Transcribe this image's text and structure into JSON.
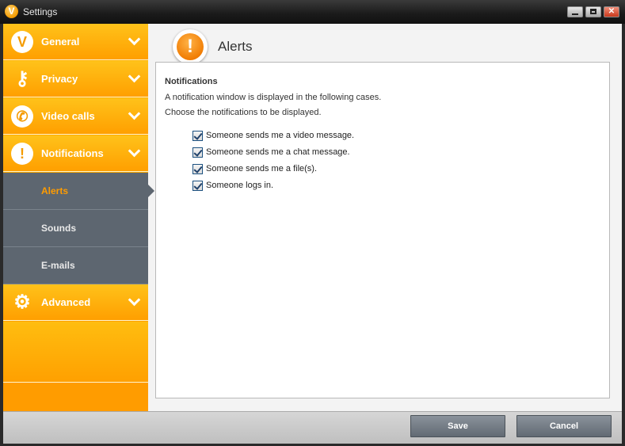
{
  "window": {
    "title": "Settings",
    "logo_letter": "V"
  },
  "sidebar": {
    "items": [
      {
        "label": "General",
        "icon": "v-logo-icon"
      },
      {
        "label": "Privacy",
        "icon": "key-icon"
      },
      {
        "label": "Video calls",
        "icon": "video-call-icon"
      },
      {
        "label": "Notifications",
        "icon": "alert-icon"
      },
      {
        "label": "Advanced",
        "icon": "gear-icon"
      }
    ],
    "subitems": [
      {
        "label": "Alerts",
        "active": true
      },
      {
        "label": "Sounds",
        "active": false
      },
      {
        "label": "E-mails",
        "active": false
      }
    ]
  },
  "main": {
    "title": "Alerts",
    "section_title": "Notifications",
    "desc1": "A notification window is displayed in the following cases.",
    "desc2": "Choose the notifications to be displayed.",
    "options": [
      {
        "label": "Someone sends me a video message.",
        "checked": true
      },
      {
        "label": "Someone sends me a chat message.",
        "checked": true
      },
      {
        "label": "Someone sends me a file(s).",
        "checked": true
      },
      {
        "label": "Someone logs in.",
        "checked": true
      }
    ]
  },
  "footer": {
    "save_label": "Save",
    "cancel_label": "Cancel"
  },
  "colors": {
    "accent": "#ff9c00",
    "sub_bg": "#5d6670"
  }
}
